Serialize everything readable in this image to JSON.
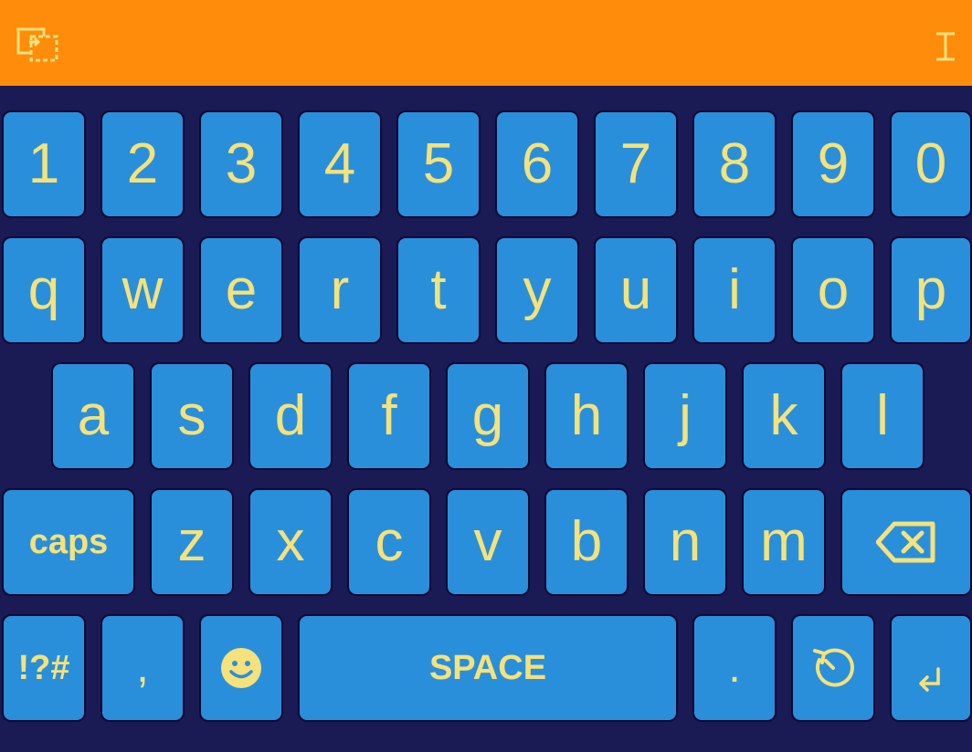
{
  "topbar": {
    "left_icon": "clipboard-select-icon",
    "right_icon": "text-cursor-icon",
    "colors": {
      "bar": "#ff8c0a",
      "icon": "#f5e27a"
    }
  },
  "keyboard": {
    "colors": {
      "background": "#1a1a55",
      "key": "#2a8fdb",
      "key_border": "#0a0a33",
      "label": "#f5e27a"
    },
    "row1": [
      "1",
      "2",
      "3",
      "4",
      "5",
      "6",
      "7",
      "8",
      "9",
      "0"
    ],
    "row2": [
      "q",
      "w",
      "e",
      "r",
      "t",
      "y",
      "u",
      "i",
      "o",
      "p"
    ],
    "row3": [
      "a",
      "s",
      "d",
      "f",
      "g",
      "h",
      "j",
      "k",
      "l"
    ],
    "row4": {
      "caps": "caps",
      "letters": [
        "z",
        "x",
        "c",
        "v",
        "b",
        "n",
        "m"
      ],
      "backspace_icon": "backspace-icon"
    },
    "row5": {
      "symbols": "!?#",
      "comma": ",",
      "emoji_icon": "smiley-icon",
      "space": "SPACE",
      "period": ".",
      "clipboard_history_icon": "clock-history-icon",
      "enter_icon": "enter-icon"
    }
  }
}
